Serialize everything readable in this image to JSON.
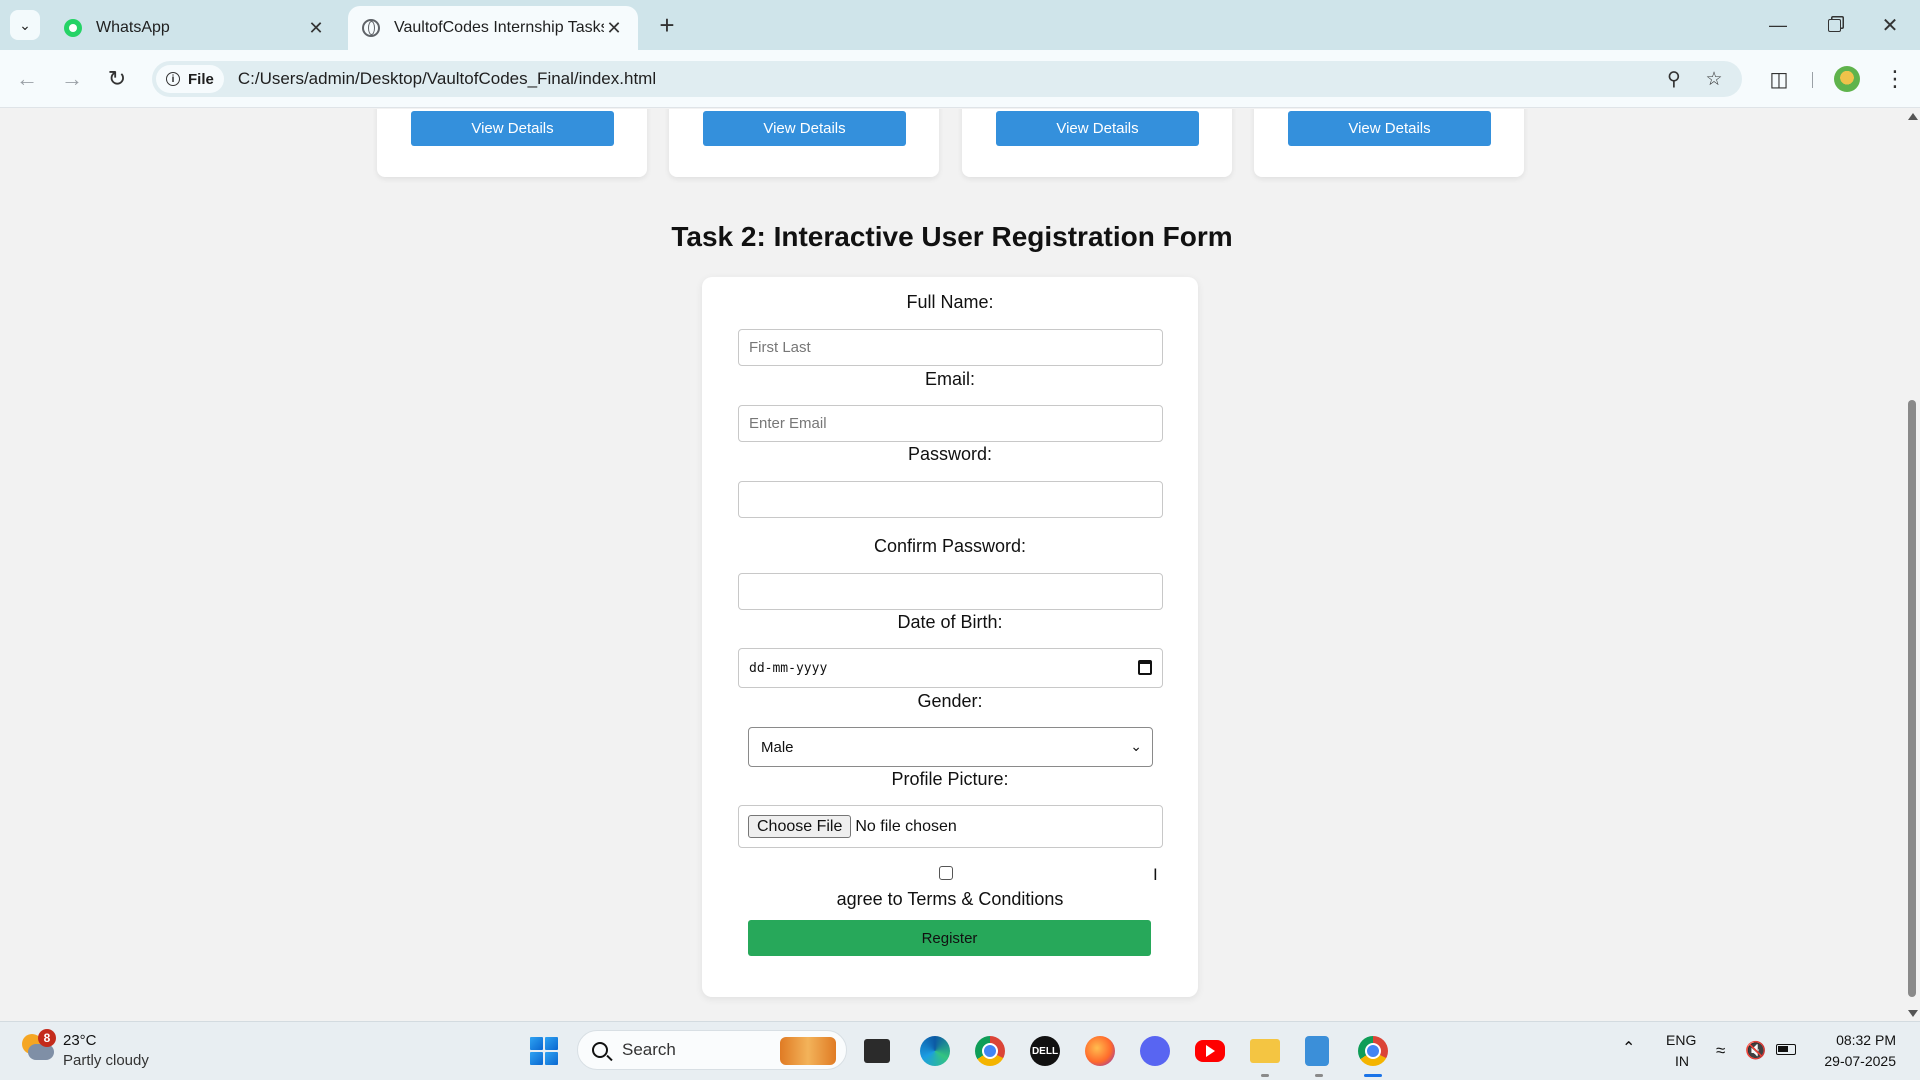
{
  "browser": {
    "tabs": [
      {
        "title": "WhatsApp",
        "icon": "whatsapp-icon",
        "active": false
      },
      {
        "title": "VaultofCodes Internship Tasks",
        "icon": "globe-icon",
        "active": true
      }
    ],
    "site_chip": "File",
    "url": "C:/Users/admin/Desktop/VaultofCodes_Final/index.html"
  },
  "cards": {
    "button_label": "View Details",
    "buttons": [
      "View Details",
      "View Details",
      "View Details",
      "View Details"
    ],
    "button_color": "#3490dc"
  },
  "section": {
    "title": "Task 2: Interactive User Registration Form"
  },
  "form": {
    "full_name_label": "Full Name:",
    "full_name_placeholder": "First Last",
    "email_label": "Email:",
    "email_placeholder": "Enter Email",
    "password_label": "Password:",
    "confirm_password_label": "Confirm Password:",
    "dob_label": "Date of Birth:",
    "dob_value": "dd-mm-yyyy",
    "gender_label": "Gender:",
    "gender_selected": "Male",
    "profile_picture_label": "Profile Picture:",
    "file_button": "Choose File",
    "file_status": "No file chosen",
    "text_cursor": "I",
    "terms_text": "agree to Terms & Conditions",
    "register_label": "Register",
    "register_color": "#27a85a"
  },
  "taskbar": {
    "weather_badge": "8",
    "weather_temp": "23°C",
    "weather_desc": "Partly cloudy",
    "search_label": "Search",
    "lang_line1": "ENG",
    "lang_line2": "IN",
    "time": "08:32 PM",
    "date": "29-07-2025"
  }
}
